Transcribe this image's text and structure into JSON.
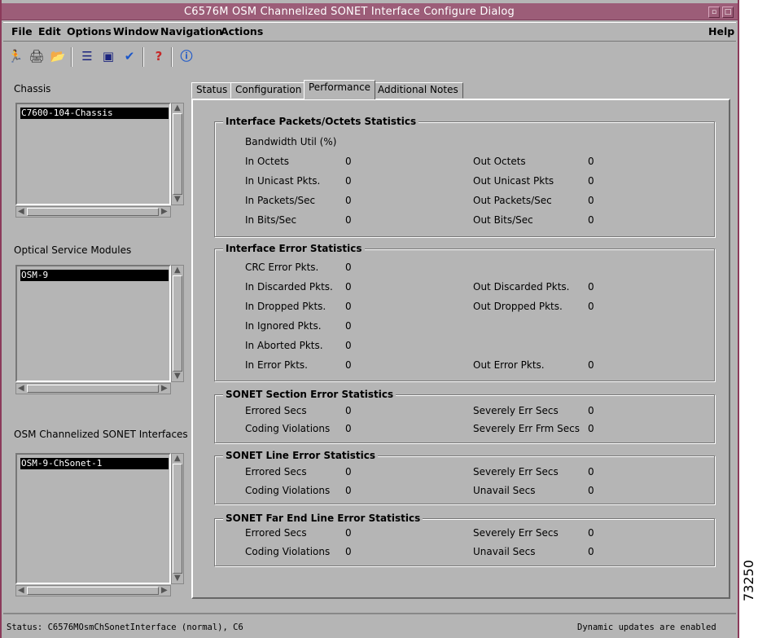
{
  "window": {
    "title": "C6576M OSM Channelized SONET Interface Configure Dialog"
  },
  "menu": {
    "file": "File",
    "edit": "Edit",
    "options": "Options",
    "window": "Window",
    "navigation": "Navigation",
    "actions": "Actions",
    "help": "Help"
  },
  "toolbar": {
    "icons": [
      "exit-icon",
      "print-icon",
      "open-folder-icon",
      "list-icon",
      "window-icon",
      "checkmark-icon",
      "help-icon",
      "info-icon"
    ]
  },
  "chassis": {
    "label": "Chassis",
    "selected": "C7600-104-Chassis"
  },
  "modules": {
    "label": "Optical Service Modules",
    "selected": "OSM-9"
  },
  "interfaces": {
    "label": "OSM Channelized SONET Interfaces",
    "selected": "OSM-9-ChSonet-1"
  },
  "tabs": {
    "status": "Status",
    "configuration": "Configuration",
    "performance": "Performance",
    "notes": "Additional Notes"
  },
  "packets": {
    "title": "Interface Packets/Octets Statistics",
    "bandwidth": "Bandwidth Util (%)",
    "in_octets": "In Octets",
    "in_octets_v": "0",
    "out_octets": "Out Octets",
    "out_octets_v": "0",
    "in_unicast": "In Unicast Pkts.",
    "in_unicast_v": "0",
    "out_unicast": "Out Unicast Pkts",
    "out_unicast_v": "0",
    "in_pps": "In Packets/Sec",
    "in_pps_v": "0",
    "out_pps": "Out Packets/Sec",
    "out_pps_v": "0",
    "in_bps": "In Bits/Sec",
    "in_bps_v": "0",
    "out_bps": "Out Bits/Sec",
    "out_bps_v": "0"
  },
  "errors": {
    "title": "Interface Error Statistics",
    "crc": "CRC Error Pkts.",
    "crc_v": "0",
    "in_disc": "In Discarded Pkts.",
    "in_disc_v": "0",
    "out_disc": "Out Discarded Pkts.",
    "out_disc_v": "0",
    "in_drop": "In Dropped Pkts.",
    "in_drop_v": "0",
    "out_drop": "Out Dropped Pkts.",
    "out_drop_v": "0",
    "in_ign": "In Ignored Pkts.",
    "in_ign_v": "0",
    "in_abort": "In Aborted Pkts.",
    "in_abort_v": "0",
    "in_err": "In Error Pkts.",
    "in_err_v": "0",
    "out_err": "Out Error Pkts.",
    "out_err_v": "0"
  },
  "section": {
    "title": "SONET Section Error Statistics",
    "es": "Errored Secs",
    "es_v": "0",
    "ses": "Severely Err Secs",
    "ses_v": "0",
    "cv": "Coding Violations",
    "cv_v": "0",
    "sefs": "Severely Err Frm Secs",
    "sefs_v": "0"
  },
  "line": {
    "title": "SONET Line Error Statistics",
    "es": "Errored Secs",
    "es_v": "0",
    "ses": "Severely Err Secs",
    "ses_v": "0",
    "cv": "Coding Violations",
    "cv_v": "0",
    "uas": "Unavail Secs",
    "uas_v": "0"
  },
  "farend": {
    "title": "SONET Far End Line Error Statistics",
    "es": "Errored Secs",
    "es_v": "0",
    "ses": "Severely Err Secs",
    "ses_v": "0",
    "cv": "Coding Violations",
    "cv_v": "0",
    "uas": "Unavail Secs",
    "uas_v": "0"
  },
  "statusbar": {
    "left": "Status: C6576MOsmChSonetInterface (normal), C6",
    "right": "Dynamic updates are enabled"
  },
  "figure_number": "73250"
}
